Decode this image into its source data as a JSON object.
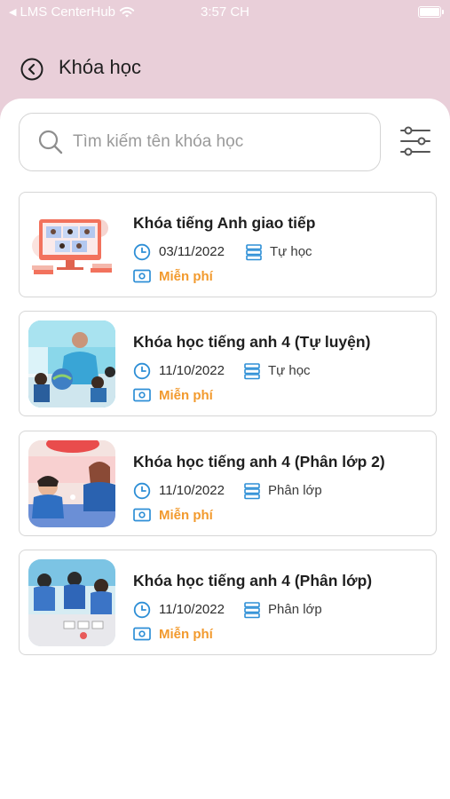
{
  "status_bar": {
    "carrier": "LMS CenterHub",
    "time": "3:57 CH"
  },
  "header": {
    "title": "Khóa học"
  },
  "search": {
    "placeholder": "Tìm kiếm tên khóa học",
    "value": ""
  },
  "colors": {
    "accent": "#2e8fd6",
    "price": "#f29a2e",
    "header_bg": "#e9cfd9"
  },
  "icons": {
    "back": "back-circle-icon",
    "search": "search-icon",
    "filter": "filter-sliders-icon",
    "date": "clock-icon",
    "type": "list-icon",
    "price": "banknote-icon"
  },
  "courses": [
    {
      "title": "Khóa tiếng Anh giao tiếp",
      "date": "03/11/2022",
      "type": "Tự học",
      "price": "Miễn phí"
    },
    {
      "title": "Khóa học tiếng anh 4 (Tự luyện)",
      "date": "11/10/2022",
      "type": "Tự học",
      "price": "Miễn phí"
    },
    {
      "title": "Khóa học tiếng anh 4 (Phân lớp 2)",
      "date": "11/10/2022",
      "type": "Phân lớp",
      "price": "Miễn phí"
    },
    {
      "title": "Khóa học tiếng anh 4 (Phân lớp)",
      "date": "11/10/2022",
      "type": "Phân lớp",
      "price": "Miễn phí"
    }
  ]
}
